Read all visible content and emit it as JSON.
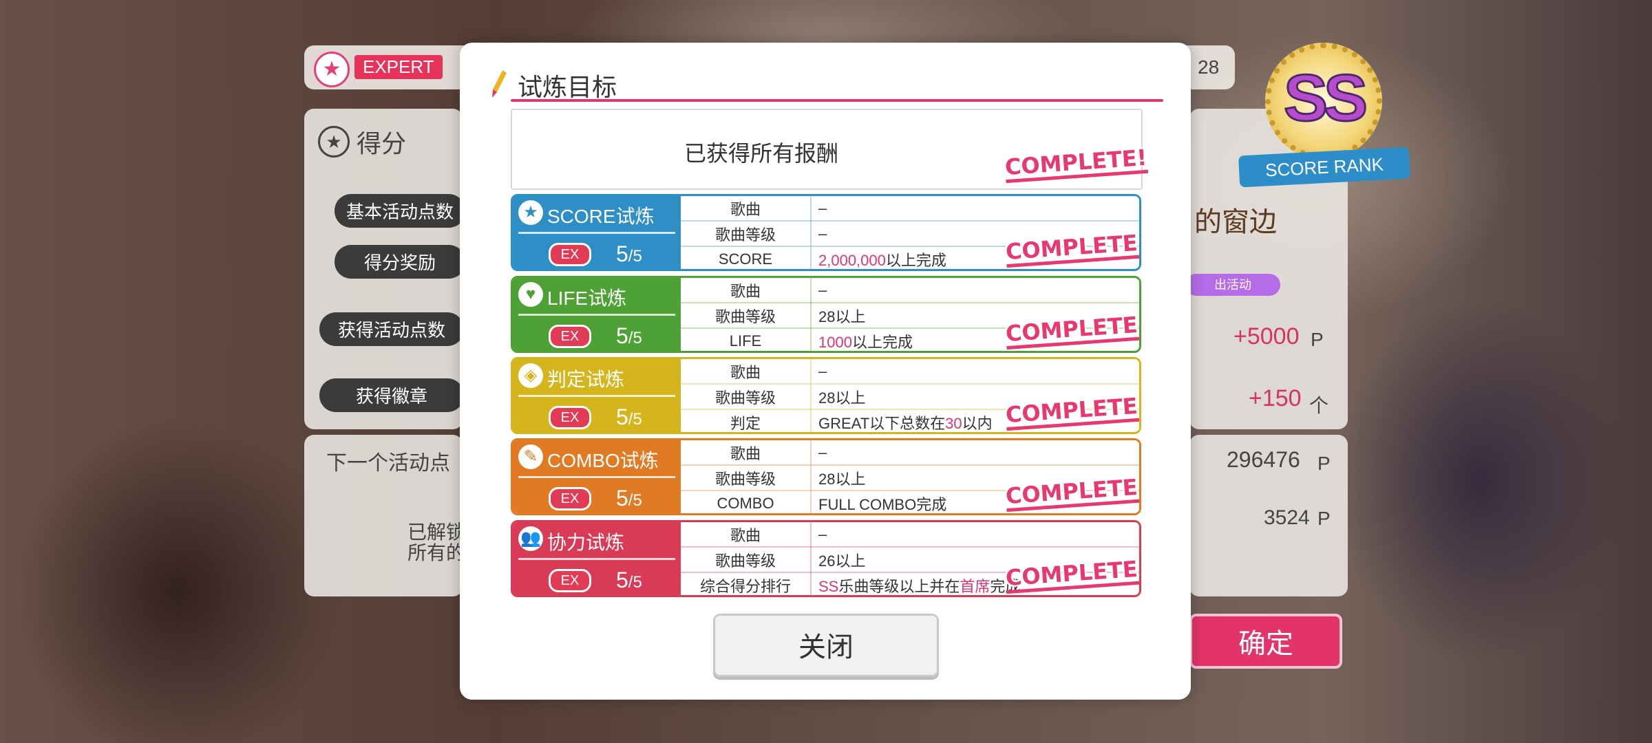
{
  "background": {
    "difficulty": "EXPERT",
    "level": "28",
    "score_section_title": "得分",
    "rows": [
      "基本活动点数",
      "得分奖励",
      "获得活动点数",
      "获得徽章"
    ],
    "next_points_label": "下一个活动点",
    "unlock_text_1": "已解锁",
    "unlock_text_2": "所有的",
    "event_points": "+5000",
    "event_points_unit": "P",
    "badges": "+150",
    "badges_unit": "个",
    "total_points": "296476",
    "total_points_unit": "P",
    "remaining_points": "3524",
    "remaining_points_unit": "P",
    "rank": "SS",
    "rank_label": "SCORE RANK",
    "event_logo_text": "的窗边",
    "event_tag": "出活动",
    "confirm_label": "确定"
  },
  "modal": {
    "title": "试炼目标",
    "reward_text": "已获得所有报酬",
    "complete_label": "COMPLETE!",
    "close_label": "关闭",
    "trials": [
      {
        "name": "SCORE试炼",
        "icon": "star-icon",
        "ex_label": "EX",
        "progress": "5",
        "total": "/5",
        "color": "#2d8fc6",
        "rows": [
          {
            "key": "歌曲",
            "value": "–"
          },
          {
            "key": "歌曲等级",
            "value": "–"
          },
          {
            "key": "SCORE",
            "value_hl": "2,000,000",
            "value_rest": "以上完成"
          }
        ]
      },
      {
        "name": "LIFE试炼",
        "icon": "heart-icon",
        "ex_label": "EX",
        "progress": "5",
        "total": "/5",
        "color": "#4ea134",
        "rows": [
          {
            "key": "歌曲",
            "value": "–"
          },
          {
            "key": "歌曲等级",
            "value": "28以上"
          },
          {
            "key": "LIFE",
            "value_hl": "1000",
            "value_rest": "以上完成"
          }
        ]
      },
      {
        "name": "判定试炼",
        "icon": "diamond-icon",
        "ex_label": "EX",
        "progress": "5",
        "total": "/5",
        "color": "#d4b51c",
        "rows": [
          {
            "key": "歌曲",
            "value": "–"
          },
          {
            "key": "歌曲等级",
            "value": "28以上"
          },
          {
            "key": "判定",
            "value_pre": "GREAT以下总数在",
            "value_hl": "30",
            "value_rest": "以内"
          }
        ]
      },
      {
        "name": "COMBO试炼",
        "icon": "pen-icon",
        "ex_label": "EX",
        "progress": "5",
        "total": "/5",
        "color": "#e07a23",
        "rows": [
          {
            "key": "歌曲",
            "value": "–"
          },
          {
            "key": "歌曲等级",
            "value": "28以上"
          },
          {
            "key": "COMBO",
            "value": "FULL COMBO完成"
          }
        ]
      },
      {
        "name": "协力试炼",
        "icon": "team-icon",
        "ex_label": "EX",
        "progress": "5",
        "total": "/5",
        "color": "#d93a56",
        "rows": [
          {
            "key": "歌曲",
            "value": "–"
          },
          {
            "key": "歌曲等级",
            "value": "26以上"
          },
          {
            "key": "综合得分排行",
            "value_hl": "SS",
            "value_rest": "乐曲等级以上并在",
            "value_hl2": "首席",
            "value_rest2": "完成"
          }
        ]
      }
    ]
  }
}
